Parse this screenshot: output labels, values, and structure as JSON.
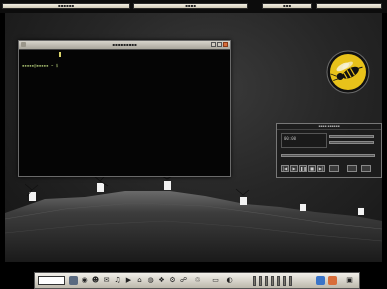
{
  "top_panel": {
    "left_label": "▪▪▪▪▪▪",
    "center_label": "▪▪▪▪",
    "right_label": "▪▪▪"
  },
  "terminal": {
    "title": "▪▪▪▪▪▪▪▪▪",
    "prompt": "▪▪▪▪▪@▪▪▪▪▪ ~ $"
  },
  "media_player": {
    "title": "▪▪▪▪ ▪▪▪▪▪▪",
    "time": "00:00",
    "buttons": [
      "|◀",
      "▶",
      "❚❚",
      "■",
      "▶|"
    ]
  },
  "dock": {
    "search_value": "",
    "icons": [
      "monitor-icon",
      "globe-icon",
      "chat-icon",
      "mail-icon",
      "music-icon",
      "player-icon",
      "home-icon",
      "camera-icon",
      "video-icon",
      "gear-icon",
      "network-icon",
      "trash-icon"
    ],
    "tray_icons": [
      "battery-icon",
      "clock-icon"
    ]
  },
  "colors": {
    "wasp_yellow": "#e8c21a",
    "close_button": "#d86d3a",
    "prompt_green": "#a8c070"
  }
}
